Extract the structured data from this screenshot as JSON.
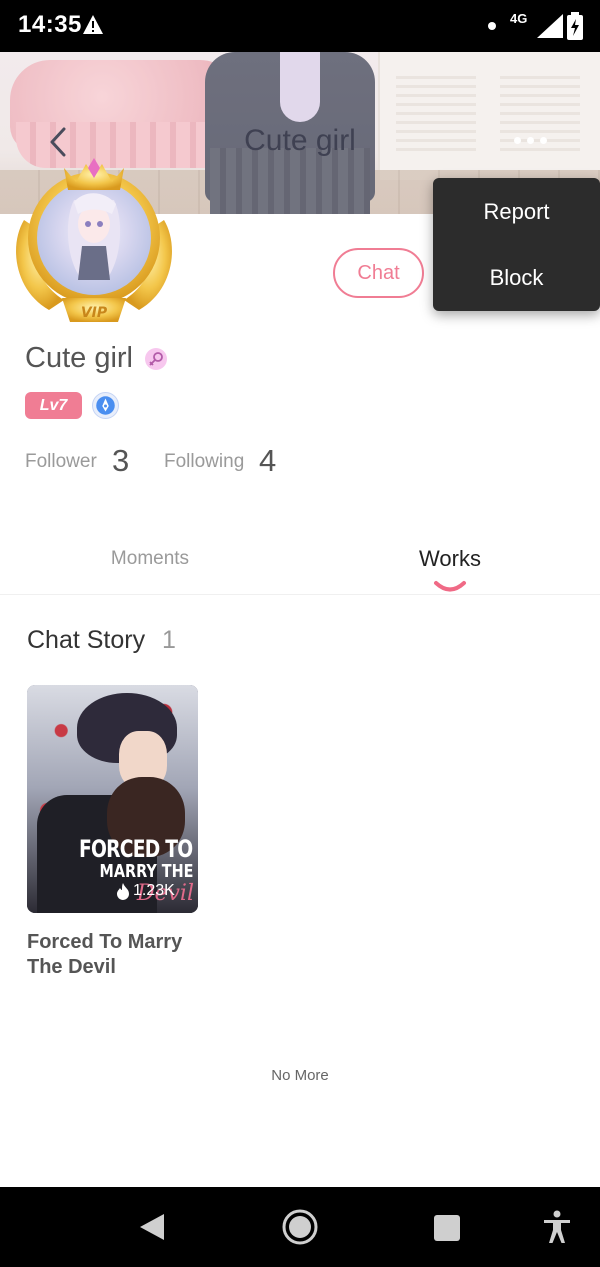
{
  "status_bar": {
    "time": "14:35",
    "network": "4G",
    "icons": [
      "warning-icon",
      "dot-icon",
      "signal-icon",
      "battery-icon"
    ]
  },
  "header": {
    "title": "Cute girl",
    "icons": [
      "back-icon",
      "more-icon"
    ]
  },
  "profile": {
    "name": "Cute girl",
    "level": "Lv7",
    "chat_label": "Chat",
    "follower_label": "Follower",
    "follower_count": "3",
    "following_label": "Following",
    "following_count": "4",
    "badges": [
      "vip-frame",
      "gender-icon",
      "pen-badge-icon"
    ]
  },
  "menu": {
    "items": [
      {
        "label": "Report"
      },
      {
        "label": "Block"
      }
    ]
  },
  "tabs": {
    "items": [
      {
        "label": "Moments",
        "active": false
      },
      {
        "label": "Works",
        "active": true
      }
    ]
  },
  "works": {
    "section_title": "Chat Story",
    "section_count": "1",
    "stories": [
      {
        "title": "Forced To Marry The Devil",
        "cover_text_1": "FORCED TO",
        "cover_text_2": "MARRY THE",
        "cover_text_3": "Devil",
        "views": "1.23K"
      }
    ],
    "end_text": "No More"
  },
  "colors": {
    "accent_pink": "#f07d94",
    "menu_bg": "#2c2c2c",
    "status_bg": "#000000"
  },
  "nav_bar": {
    "icons": [
      "nav-back-icon",
      "nav-home-icon",
      "nav-recents-icon",
      "accessibility-icon"
    ]
  }
}
